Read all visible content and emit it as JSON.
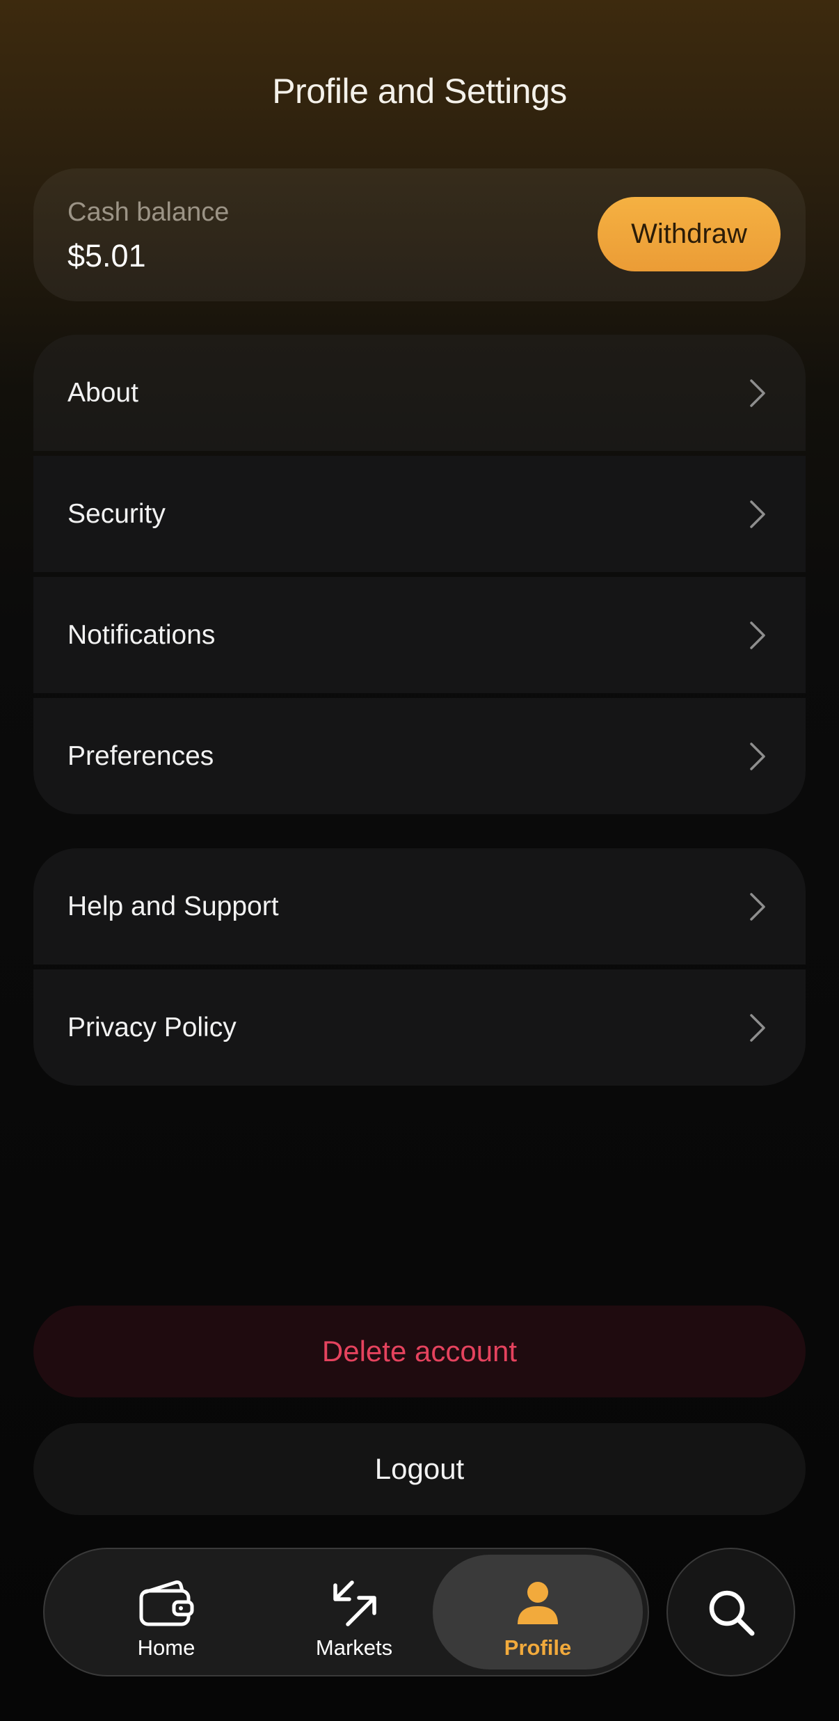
{
  "header": {
    "title": "Profile and Settings"
  },
  "balance": {
    "label": "Cash balance",
    "value": "$5.01",
    "withdraw_label": "Withdraw"
  },
  "settings_group": [
    {
      "label": "About"
    },
    {
      "label": "Security"
    },
    {
      "label": "Notifications"
    },
    {
      "label": "Preferences"
    }
  ],
  "support_group": [
    {
      "label": "Help and Support"
    },
    {
      "label": "Privacy Policy"
    }
  ],
  "actions": {
    "delete_label": "Delete account",
    "logout_label": "Logout"
  },
  "tabbar": {
    "items": [
      {
        "label": "Home",
        "icon": "wallet-icon"
      },
      {
        "label": "Markets",
        "icon": "arrows-icon"
      },
      {
        "label": "Profile",
        "icon": "person-icon",
        "active": true
      }
    ],
    "search_icon": "search-icon"
  },
  "colors": {
    "accent": "#F2AA3C",
    "danger": "#E5435E",
    "card": "#151516"
  }
}
